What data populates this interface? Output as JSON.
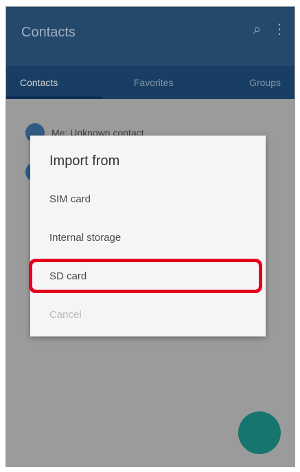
{
  "app": {
    "title": "Contacts",
    "tabs": [
      {
        "label": "Contacts",
        "active": true
      },
      {
        "label": "Favorites",
        "active": false
      },
      {
        "label": "Groups",
        "active": false
      }
    ],
    "contact_preview": "Me: Unknown contact",
    "accent": "#2c5a86",
    "fab_color": "#1c8f85"
  },
  "dialog": {
    "title": "Import from",
    "options": [
      {
        "label": "SIM card"
      },
      {
        "label": "Internal storage"
      },
      {
        "label": "SD card",
        "highlighted": true,
        "highlight_color": "#e3001b"
      },
      {
        "label": "Cancel",
        "disabled": true
      }
    ]
  }
}
